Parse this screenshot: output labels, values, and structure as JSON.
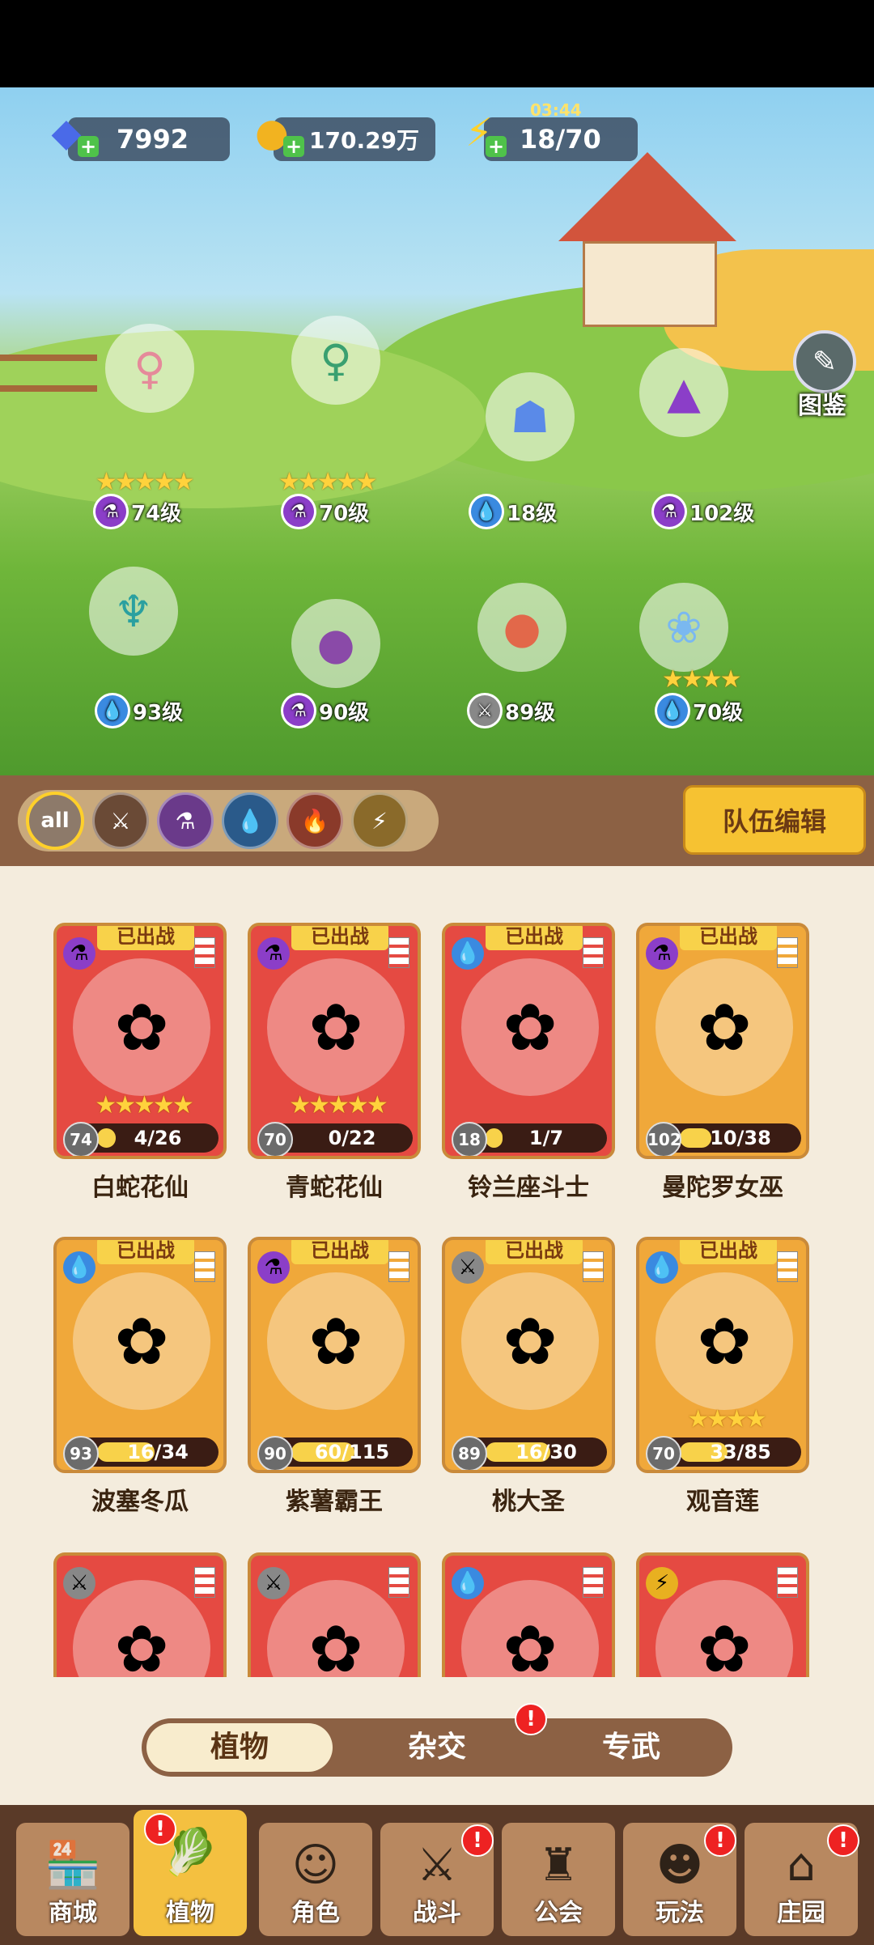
{
  "resources": {
    "gems": "7992",
    "gold": "170.29万",
    "energy": "18/70",
    "energy_timer": "03:44"
  },
  "codex_label": "图鉴",
  "heroes": [
    {
      "level": "74级",
      "stars": "★★★★★",
      "type": "potion"
    },
    {
      "level": "70级",
      "stars": "★★★★★",
      "type": "potion"
    },
    {
      "level": "18级",
      "stars": "",
      "type": "water"
    },
    {
      "level": "102级",
      "stars": "",
      "type": "potion"
    },
    {
      "level": "93级",
      "stars": "",
      "type": "water"
    },
    {
      "level": "90级",
      "stars": "",
      "type": "potion"
    },
    {
      "level": "89级",
      "stars": "",
      "type": "sword"
    },
    {
      "level": "70级",
      "stars": "★★★★",
      "type": "water"
    }
  ],
  "filters": {
    "all_label": "all",
    "icons": [
      "sword",
      "potion",
      "water",
      "fire",
      "lightning"
    ]
  },
  "team_edit_label": "队伍编辑",
  "deployed_label": "已出战",
  "cards": [
    {
      "name": "白蛇花仙",
      "level": "74",
      "progress": "4/26",
      "fraction": 0.15,
      "stars": "★★★★★",
      "style": "red",
      "type": "potion"
    },
    {
      "name": "青蛇花仙",
      "level": "70",
      "progress": "0/22",
      "fraction": 0.0,
      "stars": "★★★★★",
      "style": "red",
      "type": "potion"
    },
    {
      "name": "铃兰座斗士",
      "level": "18",
      "progress": "1/7",
      "fraction": 0.14,
      "stars": "",
      "style": "red",
      "type": "water"
    },
    {
      "name": "曼陀罗女巫",
      "level": "102",
      "progress": "10/38",
      "fraction": 0.26,
      "stars": "",
      "style": "gold",
      "type": "potion"
    },
    {
      "name": "波塞冬瓜",
      "level": "93",
      "progress": "16/34",
      "fraction": 0.47,
      "stars": "",
      "style": "gold",
      "type": "water"
    },
    {
      "name": "紫薯霸王",
      "level": "90",
      "progress": "60/115",
      "fraction": 0.52,
      "stars": "",
      "style": "gold",
      "type": "potion"
    },
    {
      "name": "桃大圣",
      "level": "89",
      "progress": "16/30",
      "fraction": 0.53,
      "stars": "",
      "style": "gold",
      "type": "sword"
    },
    {
      "name": "观音莲",
      "level": "70",
      "progress": "33/85",
      "fraction": 0.39,
      "stars": "★★★★",
      "style": "gold",
      "type": "water"
    }
  ],
  "partial_cards": [
    {
      "type": "sword"
    },
    {
      "type": "sword"
    },
    {
      "type": "water"
    },
    {
      "type": "lightning"
    }
  ],
  "subtabs": [
    "植物",
    "杂交",
    "专武"
  ],
  "nav": [
    "商城",
    "植物",
    "角色",
    "战斗",
    "公会",
    "玩法",
    "庄园"
  ],
  "alert_symbol": "!"
}
